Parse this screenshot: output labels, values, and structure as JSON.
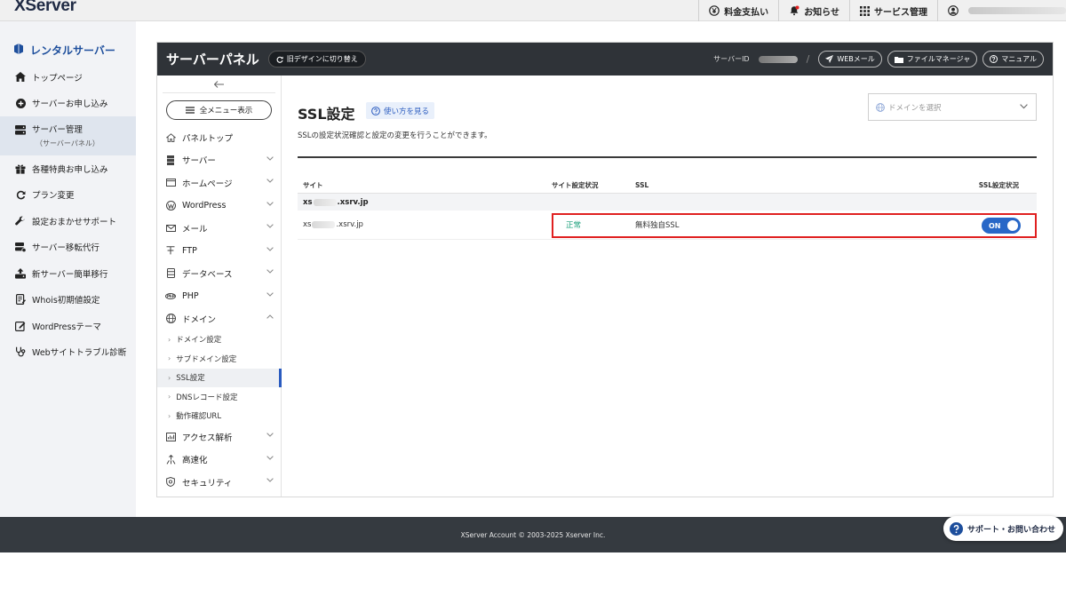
{
  "topbar": {
    "logo": "XServer",
    "nav": [
      {
        "label": "料金支払い",
        "icon": "yen-circle-icon"
      },
      {
        "label": "お知らせ",
        "icon": "bell-icon"
      },
      {
        "label": "サービス管理",
        "icon": "grid-icon"
      }
    ]
  },
  "leftnav": {
    "title": "レンタルサーバー",
    "items": [
      {
        "label": "トップページ",
        "icon": "home-icon"
      },
      {
        "label": "サーバーお申し込み",
        "icon": "plus-circle-icon"
      },
      {
        "label": "サーバー管理",
        "sub": "（サーバーパネル）",
        "icon": "server-icon"
      },
      {
        "label": "各種特典お申し込み",
        "icon": "gift-icon"
      },
      {
        "label": "プラン変更",
        "icon": "refresh-icon"
      },
      {
        "label": "設定おまかせサポート",
        "icon": "wrench-icon"
      },
      {
        "label": "サーバー移転代行",
        "icon": "server-move-icon"
      },
      {
        "label": "新サーバー簡単移行",
        "icon": "upload-icon"
      },
      {
        "label": "Whois初期値設定",
        "icon": "document-icon"
      },
      {
        "label": "WordPressテーマ",
        "icon": "edit-icon"
      },
      {
        "label": "Webサイトトラブル診断",
        "icon": "stethoscope-icon"
      }
    ]
  },
  "panel": {
    "title": "サーバーパネル",
    "old_design": "旧デザインに切り替え",
    "server_id_label": "サーバーID",
    "buttons": [
      {
        "label": "WEBメール",
        "icon": "send-icon"
      },
      {
        "label": "ファイルマネージャ",
        "icon": "folder-icon"
      },
      {
        "label": "マニュアル",
        "icon": "help-icon"
      }
    ]
  },
  "sidebar": {
    "all_menu": "全メニュー表示",
    "items": [
      {
        "label": "パネルトップ",
        "icon": "home-icon",
        "chevron": false
      },
      {
        "label": "サーバー",
        "icon": "server-icon",
        "chevron": true
      },
      {
        "label": "ホームページ",
        "icon": "browser-icon",
        "chevron": true
      },
      {
        "label": "WordPress",
        "icon": "wordpress-icon",
        "chevron": true
      },
      {
        "label": "メール",
        "icon": "mail-icon",
        "chevron": true
      },
      {
        "label": "FTP",
        "icon": "ftp-icon",
        "chevron": true
      },
      {
        "label": "データベース",
        "icon": "database-icon",
        "chevron": true
      },
      {
        "label": "PHP",
        "icon": "php-icon",
        "chevron": true
      },
      {
        "label": "ドメイン",
        "icon": "globe-icon",
        "chevron": true,
        "expanded": true
      }
    ],
    "domain_sub": [
      "ドメイン設定",
      "サブドメイン設定",
      "SSL設定",
      "DNSレコード設定",
      "動作確認URL"
    ],
    "items_after": [
      {
        "label": "アクセス解析",
        "icon": "chart-icon"
      },
      {
        "label": "高速化",
        "icon": "speed-icon"
      },
      {
        "label": "セキュリティ",
        "icon": "shield-icon"
      }
    ]
  },
  "content": {
    "title": "SSL設定",
    "howto": "使い方を見る",
    "description": "SSLの設定状況確認と設定の変更を行うことができます。",
    "domain_select_placeholder": "ドメインを選択",
    "table": {
      "headers": [
        "サイト",
        "サイト設定状況",
        "SSL",
        "SSL設定状況"
      ],
      "group": {
        "prefix": "xs",
        "suffix": ".xsrv.jp"
      },
      "row": {
        "site_prefix": "xs",
        "site_suffix": ".xsrv.jp",
        "status": "正常",
        "ssl": "無料独自SSL",
        "toggle": "ON"
      }
    }
  },
  "footer": {
    "copyright": "XServer Account © 2003-2025 Xserver Inc."
  },
  "support": {
    "label": "サポート・お問い合わせ"
  },
  "colors": {
    "accent": "#2867c7",
    "ok": "#1aa07b",
    "highlight": "#e02020",
    "panel_header": "#2f3338"
  }
}
